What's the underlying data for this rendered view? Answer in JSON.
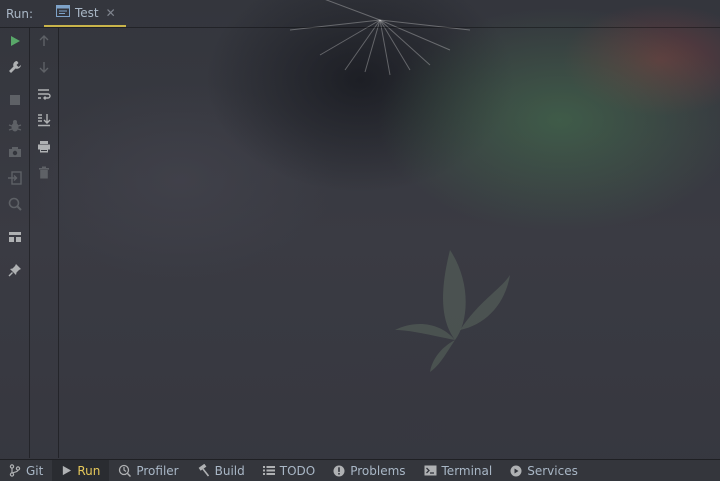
{
  "run_panel": {
    "label": "Run:",
    "tab": {
      "label": "Test",
      "icon": "console-icon",
      "close": "✕"
    }
  },
  "left_toolbar": [
    {
      "name": "rerun-button",
      "icon": "play-icon",
      "enabled": true
    },
    {
      "name": "edit-config-button",
      "icon": "wrench-icon",
      "enabled": true
    },
    {
      "name": "stop-button",
      "icon": "stop-icon",
      "enabled": false
    },
    {
      "name": "debug-button",
      "icon": "bug-icon",
      "enabled": false
    },
    {
      "name": "screenshot-button",
      "icon": "camera-icon",
      "enabled": false
    },
    {
      "name": "login-button",
      "icon": "login-icon",
      "enabled": false
    },
    {
      "name": "coverage-button",
      "icon": "coverage-icon",
      "enabled": false
    },
    {
      "name": "layout-button",
      "icon": "layout-icon",
      "enabled": true
    },
    {
      "name": "pin-button",
      "icon": "pin-icon",
      "enabled": true
    }
  ],
  "console_toolbar": [
    {
      "name": "scroll-up-button",
      "icon": "arrow-up-icon",
      "enabled": false
    },
    {
      "name": "scroll-down-button",
      "icon": "arrow-down-icon",
      "enabled": false
    },
    {
      "name": "soft-wrap-button",
      "icon": "wrap-icon",
      "enabled": true
    },
    {
      "name": "scroll-to-end-button",
      "icon": "scroll-end-icon",
      "enabled": true
    },
    {
      "name": "print-button",
      "icon": "print-icon",
      "enabled": true
    },
    {
      "name": "clear-button",
      "icon": "trash-icon",
      "enabled": false
    }
  ],
  "status_bar": [
    {
      "label": "Git",
      "icon": "git-branch-icon",
      "active": false
    },
    {
      "label": "Run",
      "icon": "play-icon",
      "active": true
    },
    {
      "label": "Profiler",
      "icon": "profiler-icon",
      "active": false
    },
    {
      "label": "Build",
      "icon": "hammer-icon",
      "active": false
    },
    {
      "label": "TODO",
      "icon": "list-icon",
      "active": false
    },
    {
      "label": "Problems",
      "icon": "info-icon",
      "active": false
    },
    {
      "label": "Terminal",
      "icon": "terminal-icon",
      "active": false
    },
    {
      "label": "Services",
      "icon": "services-icon",
      "active": false
    }
  ],
  "colors": {
    "accent": "#e6c85a",
    "run_green": "#59a869",
    "icon_gray": "#afb1b3",
    "disabled_gray": "#5e6166"
  }
}
